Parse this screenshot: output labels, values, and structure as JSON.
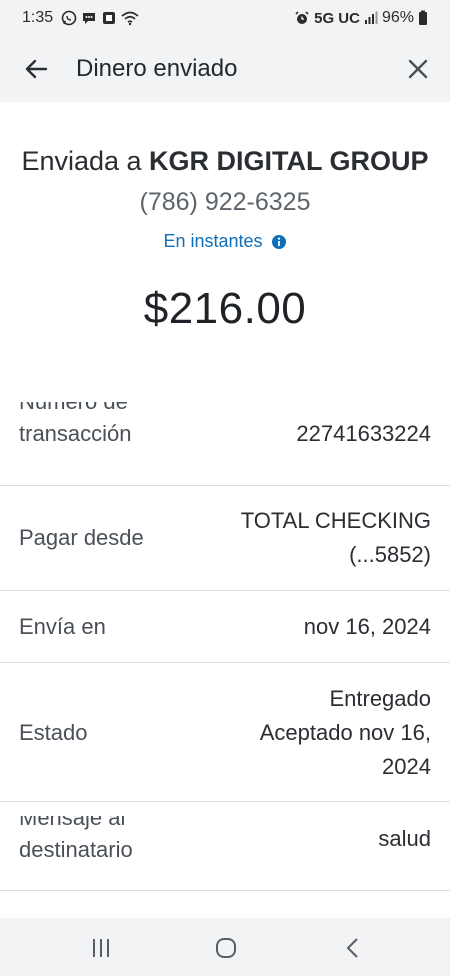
{
  "status_bar": {
    "time": "1:35",
    "network": "5G UC",
    "battery": "96%",
    "icons": [
      "whatsapp-icon",
      "chat-icon",
      "bank-icon",
      "wifi-icon",
      "alarm-icon",
      "signal-icon",
      "battery-icon"
    ]
  },
  "header": {
    "title": "Dinero enviado",
    "back_icon": "arrow-left-icon",
    "close_icon": "close-icon"
  },
  "summary": {
    "sent_prefix": "Enviada a ",
    "recipient": "KGR DIGITAL GROUP",
    "phone": "(786) 922-6325",
    "speed": "En instantes",
    "amount": "$216.00"
  },
  "details": [
    {
      "label_line1": "Número de",
      "label_line2": "transacción",
      "value": "22741633224"
    },
    {
      "label": "Pagar desde",
      "value_line1": "TOTAL CHECKING",
      "value_line2": "(...5852)"
    },
    {
      "label": "Envía en",
      "value": "nov 16, 2024"
    },
    {
      "label": "Estado",
      "value_line1": "Entregado",
      "value_line2": "Aceptado nov 16,",
      "value_line3": "2024"
    },
    {
      "label_line1": "Mensaje al",
      "label_line2": "destinatario",
      "value": "salud"
    }
  ],
  "colors": {
    "link_blue": "#0f6fb8",
    "header_bg": "#f2f3f5",
    "divider": "#d8dbdf"
  }
}
